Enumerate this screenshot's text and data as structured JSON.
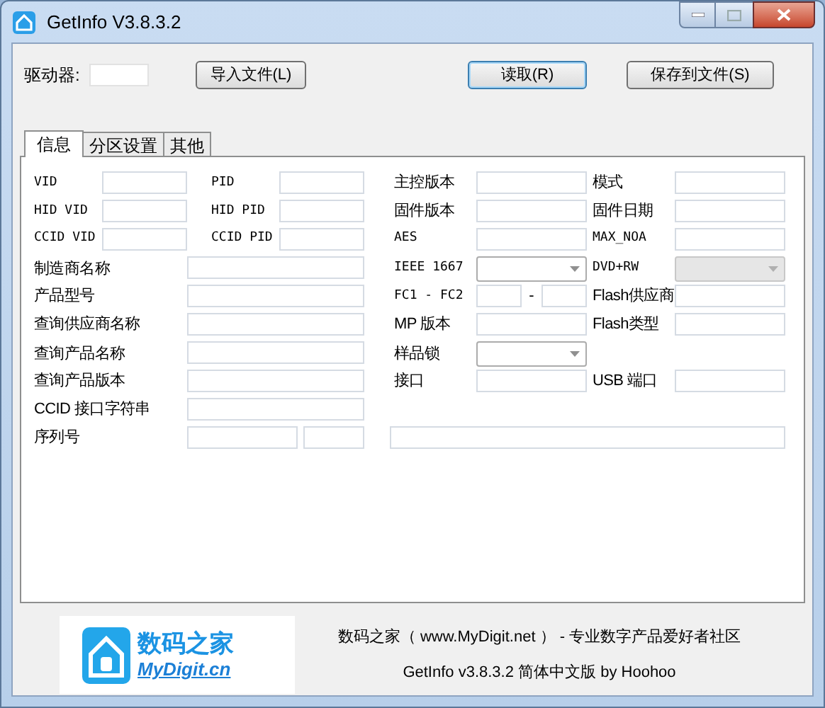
{
  "window": {
    "title": "GetInfo V3.8.3.2"
  },
  "toolbar": {
    "drive_label": "驱动器:",
    "buttons": [
      {
        "label": "导入文件(L)",
        "default": false
      },
      {
        "label": "读取(R)",
        "default": true
      },
      {
        "label": "保存到文件(S)",
        "default": false
      }
    ]
  },
  "tabs": [
    {
      "label": "信息",
      "selected": true
    },
    {
      "label": "分区设置",
      "selected": false
    },
    {
      "label": "其他",
      "selected": false
    }
  ],
  "rows": [
    [
      {
        "kind": "short",
        "label": "VID"
      },
      {
        "kind": "short",
        "label": "PID"
      },
      {
        "kind": "short",
        "label": "主控版本"
      },
      {
        "kind": "short",
        "label": "模式"
      }
    ],
    [
      {
        "kind": "short",
        "label": "HID VID"
      },
      {
        "kind": "short",
        "label": "HID PID"
      },
      {
        "kind": "short",
        "label": "固件版本"
      },
      {
        "kind": "short",
        "label": "固件日期"
      }
    ],
    [
      {
        "kind": "short",
        "label": "CCID VID"
      },
      {
        "kind": "short",
        "label": "CCID PID"
      },
      {
        "kind": "short",
        "label": "AES"
      },
      {
        "kind": "short",
        "label": "MAX_NOA"
      }
    ],
    [
      {
        "kind": "long",
        "label": "制造商名称"
      },
      {
        "kind": "combo",
        "label": "IEEE 1667",
        "disabled": false
      },
      {
        "kind": "combo",
        "label": "DVD+RW",
        "disabled": true
      }
    ],
    [
      {
        "kind": "long",
        "label": "产品型号"
      },
      {
        "kind": "range",
        "label": "FC1 - FC2",
        "separator": "-"
      },
      {
        "kind": "short",
        "label": "Flash供应商"
      }
    ],
    [
      {
        "kind": "long",
        "label": "查询供应商名称"
      },
      {
        "kind": "short",
        "label": "MP 版本"
      },
      {
        "kind": "short",
        "label": "Flash类型"
      }
    ],
    [
      {
        "kind": "long",
        "label": "查询产品名称"
      },
      {
        "kind": "combo",
        "label": "样品锁",
        "disabled": false
      }
    ],
    [
      {
        "kind": "long",
        "label": "查询产品版本"
      },
      {
        "kind": "short",
        "label": "接口"
      },
      {
        "kind": "short",
        "label": "USB 端口"
      }
    ],
    [
      {
        "kind": "long",
        "label": "CCID 接口字符串"
      }
    ],
    [
      {
        "kind": "split",
        "label": "序列号"
      },
      {
        "kind": "field"
      }
    ]
  ],
  "footer": {
    "logo_title": "数码之家",
    "logo_subtitle": "MyDigit.cn",
    "lines": [
      "数码之家（ www.MyDigit.net ） - 专业数字产品爱好者社区",
      "GetInfo v3.8.3.2 简体中文版 by Hoohoo"
    ]
  }
}
